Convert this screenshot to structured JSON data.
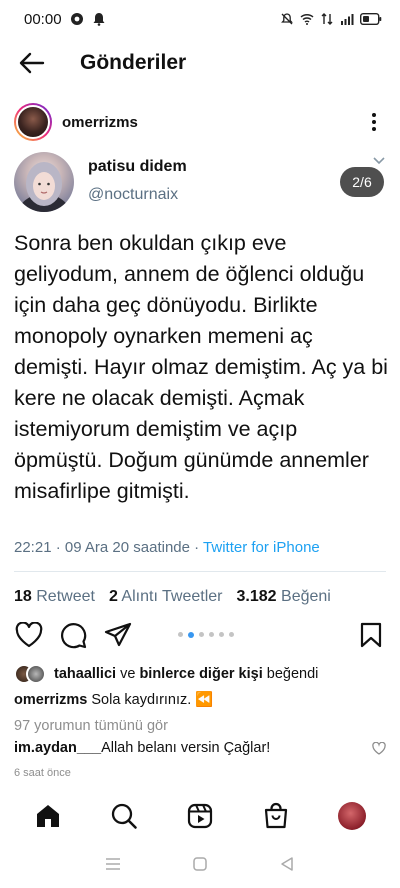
{
  "status_bar": {
    "time": "00:00"
  },
  "header": {
    "title": "Gönderiler"
  },
  "post": {
    "username": "omerrizms"
  },
  "tweet": {
    "display_name": "patisu didem",
    "handle": "@nocturnaix",
    "counter": "2/6",
    "text": "Sonra ben okuldan çıkıp eve geliyodum, annem de öğlenci olduğu için daha geç dönüyodu. Birlikte monopoly oynarken memeni aç demişti. Hayır olmaz demiştim. Aç ya bi kere ne olacak demişti. Açmak istemiyorum demiştim ve açıp öpmüştü. Doğum günümde annemler misafirlipe gitmişti.",
    "timestamp": "22:21 · 09 Ara 20 saatinde · ",
    "source": "Twitter for iPhone",
    "retweets": "18",
    "retweets_label": "Retweet",
    "quotes": "2",
    "quotes_label": "Alıntı Tweetler",
    "likes": "3.182",
    "likes_label": "Beğeni"
  },
  "carousel": {
    "total": 6,
    "active_index": 1
  },
  "likes_line": {
    "user": "tahaallici",
    "mid": " ve ",
    "others": "binlerce diğer kişi",
    "suffix": " beğendi"
  },
  "caption": {
    "user": "omerrizms",
    "text": " Sola kaydırınız. ",
    "emoji": "⏪"
  },
  "view_all_comments": "97 yorumun tümünü gör",
  "comment": {
    "user": "im.aydan___",
    "text": "  Allah belanı versin Çağlar!"
  },
  "time_ago": "6 saat önce",
  "icons": {
    "back": "arrow-left-icon",
    "more": "more-vertical-icon",
    "like": "heart-icon",
    "comment": "comment-icon",
    "share": "send-icon",
    "save": "bookmark-icon",
    "home": "home-icon",
    "search": "search-icon",
    "reels": "reels-icon",
    "shop": "shop-icon"
  },
  "colors": {
    "twitter_blue": "#1da1f2",
    "muted": "#5b7083",
    "carousel_active": "#3897f0"
  }
}
